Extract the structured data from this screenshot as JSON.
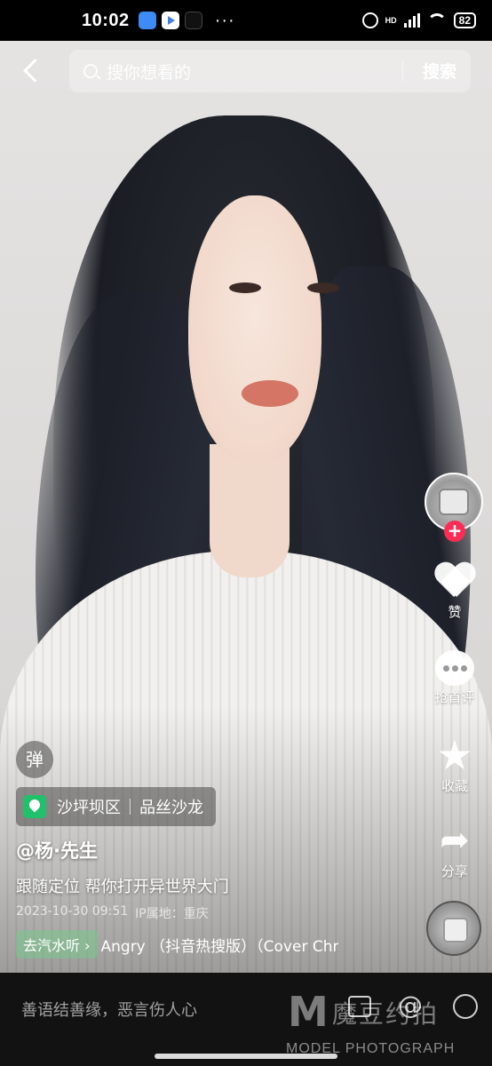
{
  "status_bar": {
    "time": "10:02",
    "dots": "···",
    "network_label": "HD",
    "battery": "82"
  },
  "search": {
    "placeholder": "搜你想看的",
    "button_label": "搜索"
  },
  "rail": {
    "follow_symbol": "+",
    "like_label": "赞",
    "comment_label": "抢首评",
    "favorite_label": "收藏",
    "share_label": "分享"
  },
  "post": {
    "danmu_label": "弹",
    "location_name": "沙坪坝区",
    "location_shop": "品丝沙龙",
    "username": "@杨·先生",
    "caption": "跟随定位 帮你打开异世界大门",
    "date": "2023-10-30 09:51",
    "ip": "IP属地：重庆",
    "music_tag": "去汽水听 ›",
    "music_title": "Angry （抖音热搜版）（Cover Chr"
  },
  "comment_bar": {
    "placeholder": "善语结善缘，恶言伤人心",
    "at_symbol": "@"
  },
  "watermark": {
    "logo": "M",
    "title": "魔豆约拍",
    "subtitle": "MODEL PHOTOGRAPH"
  },
  "icons": {
    "back": "back-icon",
    "search": "search-icon",
    "like": "heart-icon",
    "comment": "comment-icon",
    "favorite": "star-icon",
    "share": "share-icon",
    "location": "pin-icon",
    "image": "image-icon",
    "mention": "at-icon",
    "emoji": "emoji-icon"
  },
  "colors": {
    "follow_button": "#fe2c55",
    "location_pin": "#21c16b"
  }
}
